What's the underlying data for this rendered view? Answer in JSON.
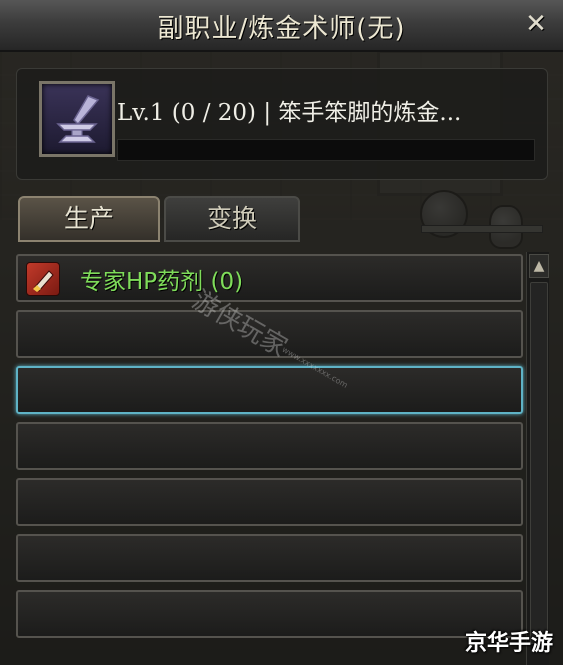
{
  "window": {
    "title": "副职业/炼金术师(无)",
    "close_glyph": "✕"
  },
  "skill": {
    "icon": "alchemy-anvil-icon",
    "level_text": "Lv.1 (0 / 20) | 笨手笨脚的炼金...",
    "exp_progress": 0
  },
  "tabs": [
    {
      "label": "生产",
      "active": true
    },
    {
      "label": "变换",
      "active": false
    }
  ],
  "recipes": [
    {
      "name": "专家HP药剂 (0)",
      "icon": "hp-potion-icon"
    }
  ],
  "watermark": {
    "text": "游侠玩家",
    "small_text": "www.xxxxxxx.com"
  },
  "corner_watermark": "京华手游",
  "colors": {
    "recipe_text": "#7fdc5a",
    "selected_border": "#5fb3c6"
  }
}
